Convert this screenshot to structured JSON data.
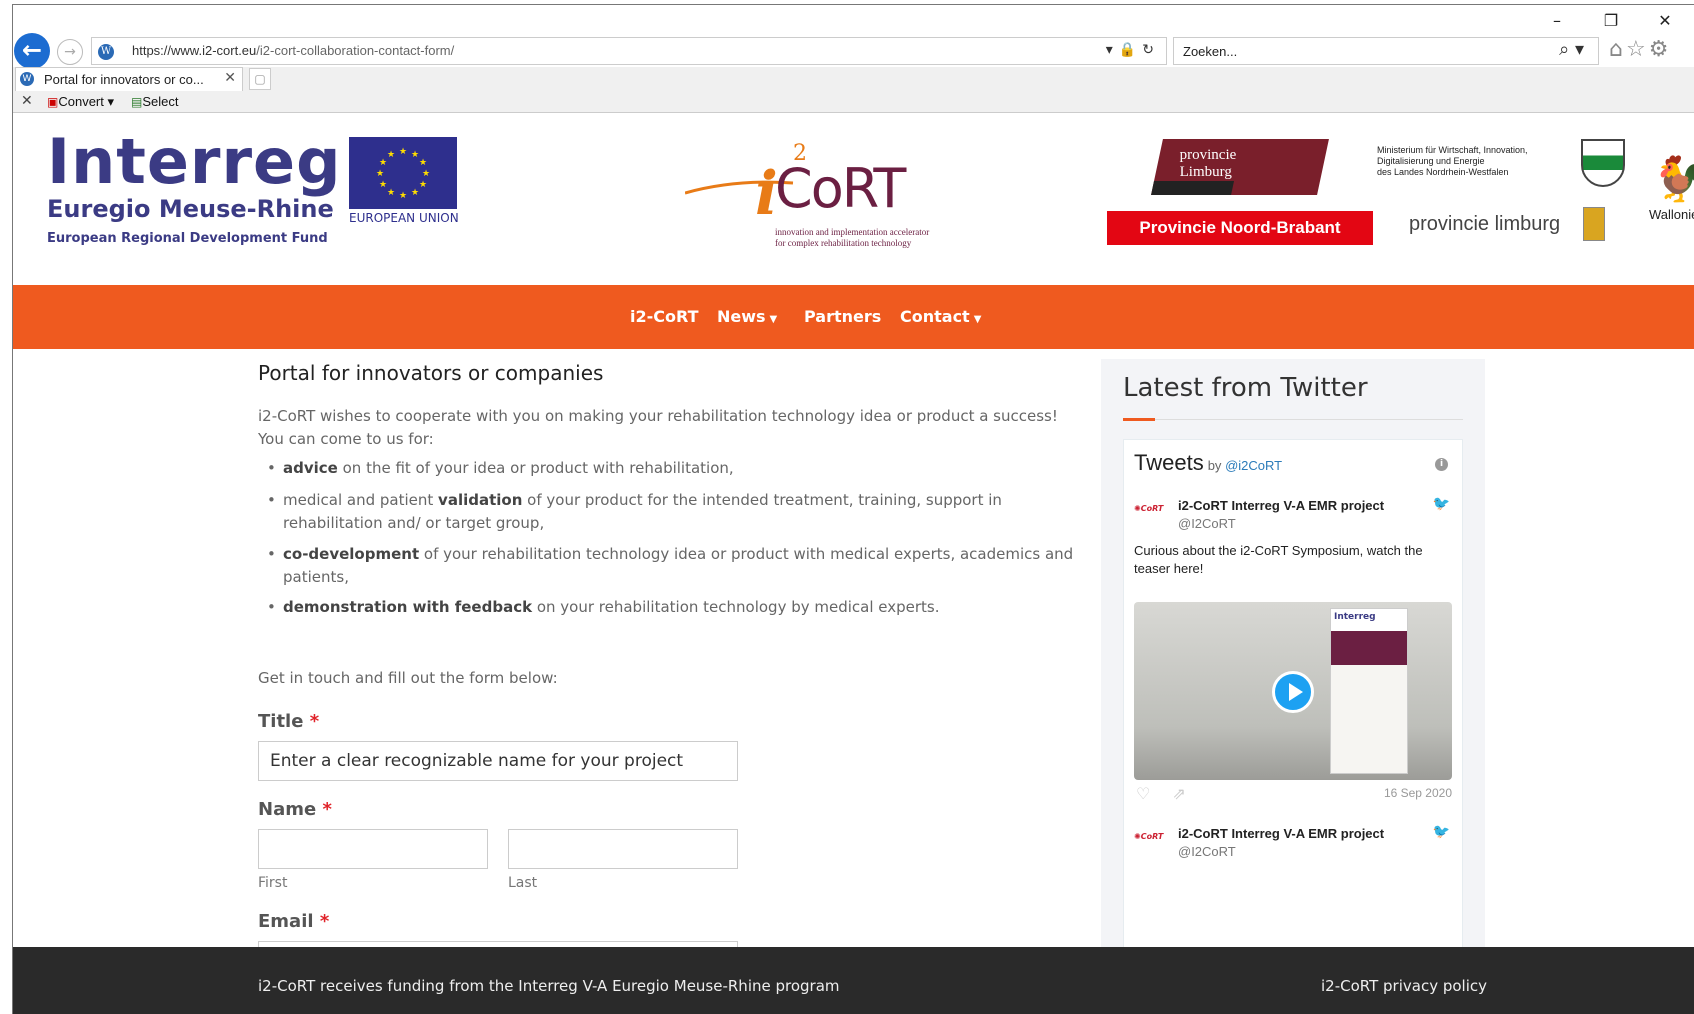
{
  "browser": {
    "url_host": "https://www.i2-cort.eu",
    "url_path": "/i2-cort-collaboration-contact-form/",
    "search_placeholder": "Zoeken...",
    "tab_title": "Portal for innovators or co...",
    "commands": {
      "convert": "Convert",
      "select": "Select"
    }
  },
  "header": {
    "interreg": "Interreg",
    "euregio": "Euregio Meuse-Rhine",
    "erdf": "European Regional Development Fund",
    "eu_label": "EUROPEAN UNION",
    "cort_name": "CoRT",
    "cort_i": "i",
    "cort_sup": "2",
    "cort_tagline_1": "innovation and implementation accelerator",
    "cort_tagline_2": "for complex rehabilitation technology",
    "limburg_logo": "provincie Limburg",
    "noord_brabant": "Provincie Noord-Brabant",
    "nrw_1": "Ministerium für Wirtschaft, Innovation,",
    "nrw_2": "Digitalisierung und Energie",
    "nrw_3": "des Landes Nordrhein-Westfalen",
    "provincie_limburg": "provincie limburg",
    "wallonie": "Wallonie"
  },
  "nav": {
    "items": [
      {
        "label": "i2-CoRT"
      },
      {
        "label": "News"
      },
      {
        "label": "Partners"
      },
      {
        "label": "Contact"
      }
    ]
  },
  "main": {
    "title": "Portal for innovators or companies",
    "intro": "i2-CoRT wishes to cooperate with you on making your rehabilitation technology idea or product a success! You can come to us for:",
    "list": [
      {
        "bold": "advice",
        "rest": " on the fit of your idea or product with rehabilitation,"
      },
      {
        "pre": "medical and patient ",
        "bold": "validation",
        "rest": " of your product for the intended treatment, training, support in rehabilitation and/ or target group,"
      },
      {
        "bold": "co-development",
        "rest": " of your rehabilitation technology idea or product with medical experts, academics and patients,"
      },
      {
        "bold": "demonstration with feedback",
        "rest": " on your rehabilitation technology by medical experts."
      }
    ],
    "get_in_touch": "Get in touch and fill out the form below:",
    "form": {
      "title_label": "Title",
      "title_value": "Enter a clear recognizable name for your project",
      "name_label": "Name",
      "first_label": "First",
      "last_label": "Last",
      "email_label": "Email",
      "required_mark": "*"
    }
  },
  "sidebar": {
    "heading": "Latest from Twitter",
    "tweets_label": "Tweets",
    "by": "by",
    "handle_link": "@i2CoRT",
    "tweets": [
      {
        "name": "i2-CoRT Interreg V-A EMR project",
        "handle": "@I2CoRT",
        "text": "Curious about the i2-CoRT Symposium, watch the teaser here!",
        "date": "16 Sep 2020"
      },
      {
        "name": "i2-CoRT Interreg V-A EMR project",
        "handle": "@I2CoRT"
      }
    ],
    "video_banner_text": "Interreg"
  },
  "footer": {
    "funding": "i2-CoRT receives funding from the Interreg V-A Euregio Meuse-Rhine program",
    "privacy": "i2-CoRT privacy policy"
  },
  "colors": {
    "accent": "#ef5a1f",
    "brand": "#3b3b84",
    "footer": "#2a2a2a"
  }
}
